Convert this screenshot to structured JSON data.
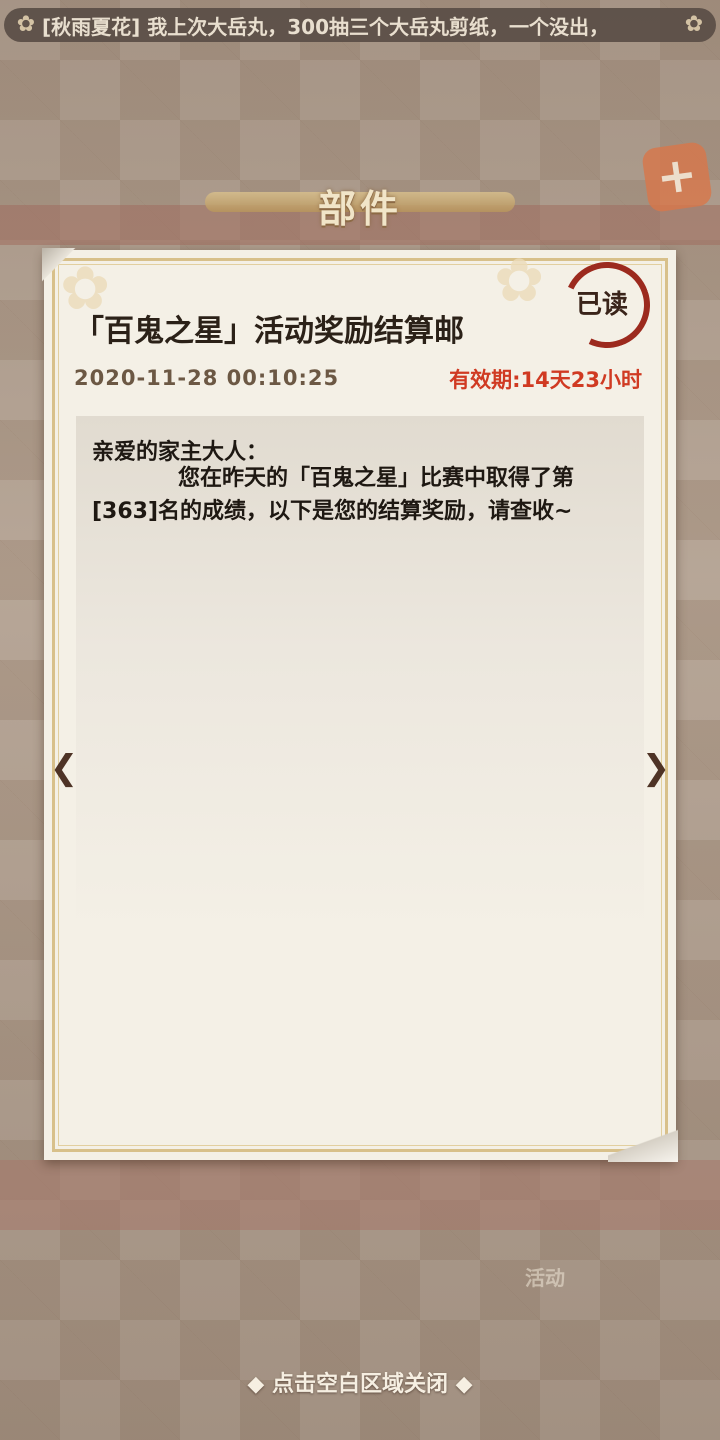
{
  "marquee": {
    "text": "[秋雨夏花] 我上次大岳丸，300抽三个大岳丸剪纸，一个没出，",
    "left_icon": "flower-icon",
    "right_icon": "flower-icon"
  },
  "header": {
    "title": "部件",
    "close_icon": "close-icon"
  },
  "letter": {
    "subject": "「百鬼之星」活动奖励结算邮",
    "status_stamp": "已读",
    "date": "2020-11-28 00:10:25",
    "validity": "有效期:14天23小时",
    "greeting": "亲爱的家主大人：",
    "message": "您在昨天的「百鬼之星」比赛中取得了第[363]名的成绩，以下是您的结算奖励，请查收~"
  },
  "nav": {
    "prev_icon": "chevron-left-icon",
    "next_icon": "chevron-right-icon"
  },
  "background": {
    "faded_label": "活动"
  },
  "footer": {
    "close_hint": "◆ 点击空白区域关闭 ◆"
  },
  "colors": {
    "validity": "#d03a22",
    "stamp": "#9c2a1e",
    "paper": "#f4f0e6"
  }
}
